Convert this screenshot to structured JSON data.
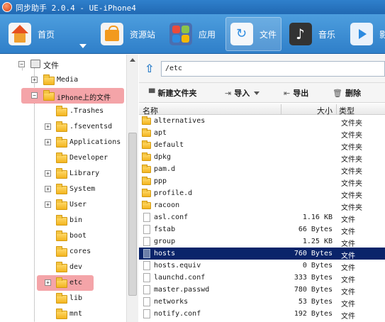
{
  "title": "同步助手 2.0.4 - UE-iPhone4",
  "toolbar": {
    "items": [
      {
        "label": "首页",
        "icon": "home-icon"
      },
      {
        "label": "资源站",
        "icon": "shopping-bag-icon"
      },
      {
        "label": "应用",
        "icon": "apps-icon"
      },
      {
        "label": "文件",
        "icon": "file-sync-icon"
      },
      {
        "label": "音乐",
        "icon": "music-icon"
      },
      {
        "label": "影",
        "icon": "video-icon"
      }
    ],
    "active": "文件"
  },
  "tree": {
    "root": "文件",
    "iphone_files": "iPhone上的文件",
    "top_items": [
      "Media"
    ],
    "children": [
      {
        "label": ".Trashes",
        "expandable": false
      },
      {
        "label": ".fseventsd",
        "expandable": true
      },
      {
        "label": "Applications",
        "expandable": true
      },
      {
        "label": "Developer",
        "expandable": false
      },
      {
        "label": "Library",
        "expandable": true
      },
      {
        "label": "System",
        "expandable": true
      },
      {
        "label": "User",
        "expandable": true
      },
      {
        "label": "bin",
        "expandable": false
      },
      {
        "label": "boot",
        "expandable": false
      },
      {
        "label": "cores",
        "expandable": false
      },
      {
        "label": "dev",
        "expandable": false
      },
      {
        "label": "etc",
        "expandable": true,
        "highlighted": true
      },
      {
        "label": "lib",
        "expandable": false
      },
      {
        "label": "mnt",
        "expandable": false
      }
    ]
  },
  "path": {
    "value": "/etc"
  },
  "actions": {
    "new_folder": "新建文件夹",
    "import": "导入",
    "export": "导出",
    "delete": "删除"
  },
  "table": {
    "headers": {
      "name": "名称",
      "size": "大小",
      "type": "类型"
    },
    "rows": [
      {
        "name": "alternatives",
        "size": "",
        "type": "文件夹",
        "kind": "folder"
      },
      {
        "name": "apt",
        "size": "",
        "type": "文件夹",
        "kind": "folder"
      },
      {
        "name": "default",
        "size": "",
        "type": "文件夹",
        "kind": "folder"
      },
      {
        "name": "dpkg",
        "size": "",
        "type": "文件夹",
        "kind": "folder"
      },
      {
        "name": "pam.d",
        "size": "",
        "type": "文件夹",
        "kind": "folder"
      },
      {
        "name": "ppp",
        "size": "",
        "type": "文件夹",
        "kind": "folder"
      },
      {
        "name": "profile.d",
        "size": "",
        "type": "文件夹",
        "kind": "folder"
      },
      {
        "name": "racoon",
        "size": "",
        "type": "文件夹",
        "kind": "folder"
      },
      {
        "name": "asl.conf",
        "size": "1.16 KB",
        "type": "文件",
        "kind": "file"
      },
      {
        "name": "fstab",
        "size": "66 Bytes",
        "type": "文件",
        "kind": "file"
      },
      {
        "name": "group",
        "size": "1.25 KB",
        "type": "文件",
        "kind": "file"
      },
      {
        "name": "hosts",
        "size": "760 Bytes",
        "type": "文件",
        "kind": "file",
        "selected": true
      },
      {
        "name": "hosts.equiv",
        "size": "0 Bytes",
        "type": "文件",
        "kind": "file"
      },
      {
        "name": "launchd.conf",
        "size": "333 Bytes",
        "type": "文件",
        "kind": "file"
      },
      {
        "name": "master.passwd",
        "size": "780 Bytes",
        "type": "文件",
        "kind": "file"
      },
      {
        "name": "networks",
        "size": "53 Bytes",
        "type": "文件",
        "kind": "file"
      },
      {
        "name": "notify.conf",
        "size": "192 Bytes",
        "type": "文件",
        "kind": "file"
      }
    ]
  },
  "colors": {
    "accent": "#2f7fc9",
    "highlight": "#f4a4a8",
    "selection": "#0a246a"
  }
}
